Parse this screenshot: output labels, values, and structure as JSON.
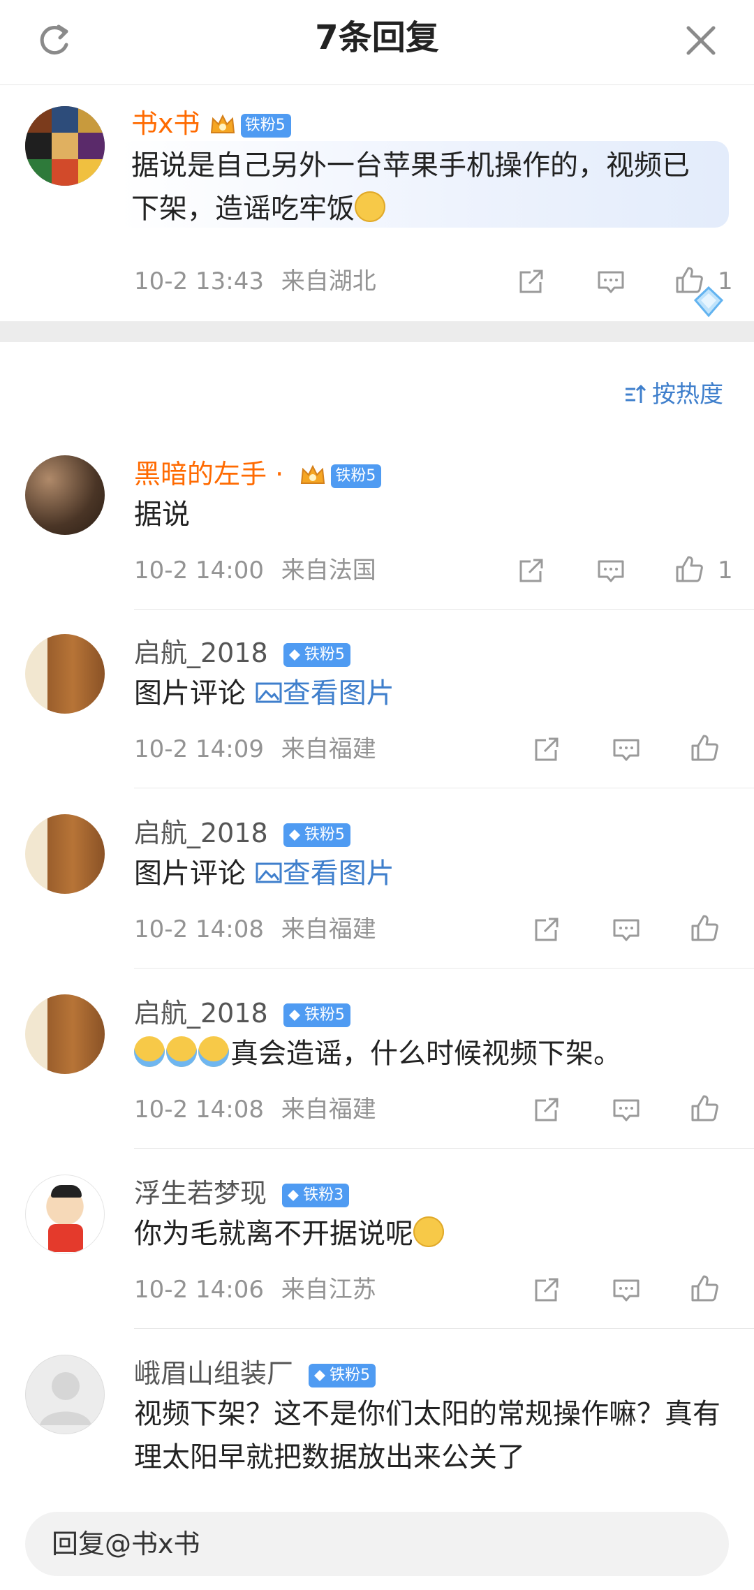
{
  "header": {
    "title": "7条回复"
  },
  "original": {
    "name": "书x书",
    "badge": "铁粉5",
    "text": "据说是自己另外一台苹果手机操作的，视频已下架，造谣吃牢饭",
    "time": "10-2 13:43",
    "location": "来自湖北",
    "likes": "1"
  },
  "sort": {
    "label": "按热度"
  },
  "comments": [
    {
      "name": "黑暗的左手 ·",
      "badge": "铁粉5",
      "text": "据说",
      "time": "10-2 14:00",
      "location": "来自法国",
      "likes": "1"
    },
    {
      "name": "启航_2018",
      "badge": "铁粉5",
      "text": "图片评论",
      "link": "查看图片",
      "time": "10-2 14:09",
      "location": "来自福建"
    },
    {
      "name": "启航_2018",
      "badge": "铁粉5",
      "text": "图片评论",
      "link": "查看图片",
      "time": "10-2 14:08",
      "location": "来自福建"
    },
    {
      "name": "启航_2018",
      "badge": "铁粉5",
      "text": "真会造谣，什么时候视频下架。",
      "time": "10-2 14:08",
      "location": "来自福建"
    },
    {
      "name": "浮生若梦现",
      "badge": "铁粉3",
      "text": "你为毛就离不开据说呢",
      "time": "10-2 14:06",
      "location": "来自江苏"
    },
    {
      "name": "峨眉山组装厂",
      "badge": "铁粉5",
      "text": "视频下架？这不是你们太阳的常规操作嘛？真有理太阳早就把数据放出来公关了"
    }
  ],
  "reply": {
    "placeholder": "回复@书x书"
  },
  "colors": {
    "vip_name": "#ff6a00",
    "link": "#3f7fcc",
    "badge": "#4f9bf2"
  },
  "icons": [
    "refresh-icon",
    "close-icon",
    "share-icon",
    "comment-icon",
    "like-icon",
    "sort-icon",
    "image-icon"
  ]
}
